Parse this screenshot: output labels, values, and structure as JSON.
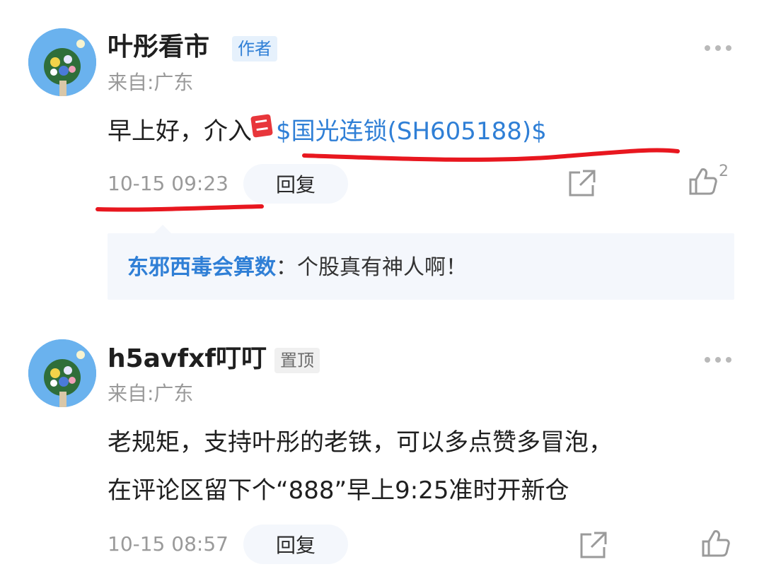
{
  "colors": {
    "link": "#2f7fd6",
    "annotation": "#e8171f",
    "muted": "#9a9a9a"
  },
  "comments": [
    {
      "username": "叶彤看市",
      "badge": "作者",
      "location": "来自:广东",
      "content_prefix": "早上好，介入",
      "stock_icon": "buy-icon",
      "stock_link": "$国光连锁(SH605188)$",
      "timestamp": "10-15 09:23",
      "reply_label": "回复",
      "like_count": "2",
      "reply": {
        "author": "东邪西毒会算数",
        "text": "：个股真有神人啊！"
      }
    },
    {
      "username": "h5avfxf叮叮",
      "badge": "置顶",
      "location": "来自:广东",
      "content_line1": "老规矩，支持叶彤的老铁，可以多点赞多冒泡，",
      "content_line2": "在评论区留下个“888”早上9:25准时开新仓",
      "timestamp": "10-15 08:57",
      "reply_label": "回复"
    }
  ]
}
